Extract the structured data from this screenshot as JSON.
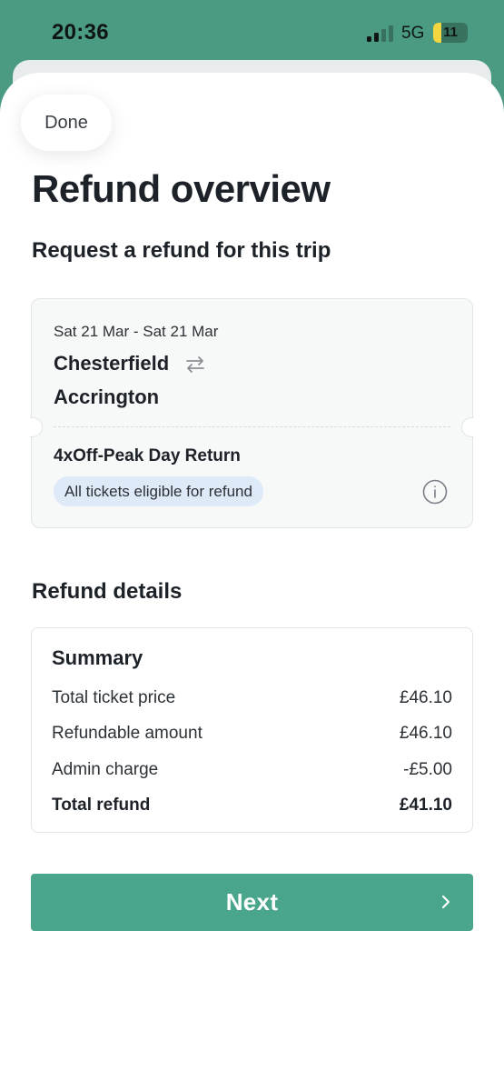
{
  "status_bar": {
    "time": "20:36",
    "network": "5G",
    "battery": "11",
    "battery_color": "#f4d640",
    "background": "#4b9a83"
  },
  "header": {
    "done_label": "Done",
    "title": "Refund overview",
    "subtitle": "Request a refund for this trip"
  },
  "trip": {
    "dates": "Sat 21 Mar - Sat 21 Mar",
    "origin": "Chesterfield",
    "destination": "Accrington",
    "direction_icon": "return-arrows-icon",
    "ticket_type": "4xOff-Peak Day Return",
    "eligibility": "All tickets eligible for refund",
    "info_icon": "info-icon"
  },
  "refund_details": {
    "section_title": "Refund details",
    "summary_title": "Summary",
    "rows": [
      {
        "label": "Total ticket price",
        "value": "£46.10"
      },
      {
        "label": "Refundable amount",
        "value": "£46.10"
      },
      {
        "label": "Admin charge",
        "value": "-£5.00"
      },
      {
        "label": "Total refund",
        "value": "£41.10"
      }
    ]
  },
  "footer": {
    "next_label": "Next",
    "next_icon": "chevron-right-icon",
    "accent_color": "#49a58b"
  }
}
